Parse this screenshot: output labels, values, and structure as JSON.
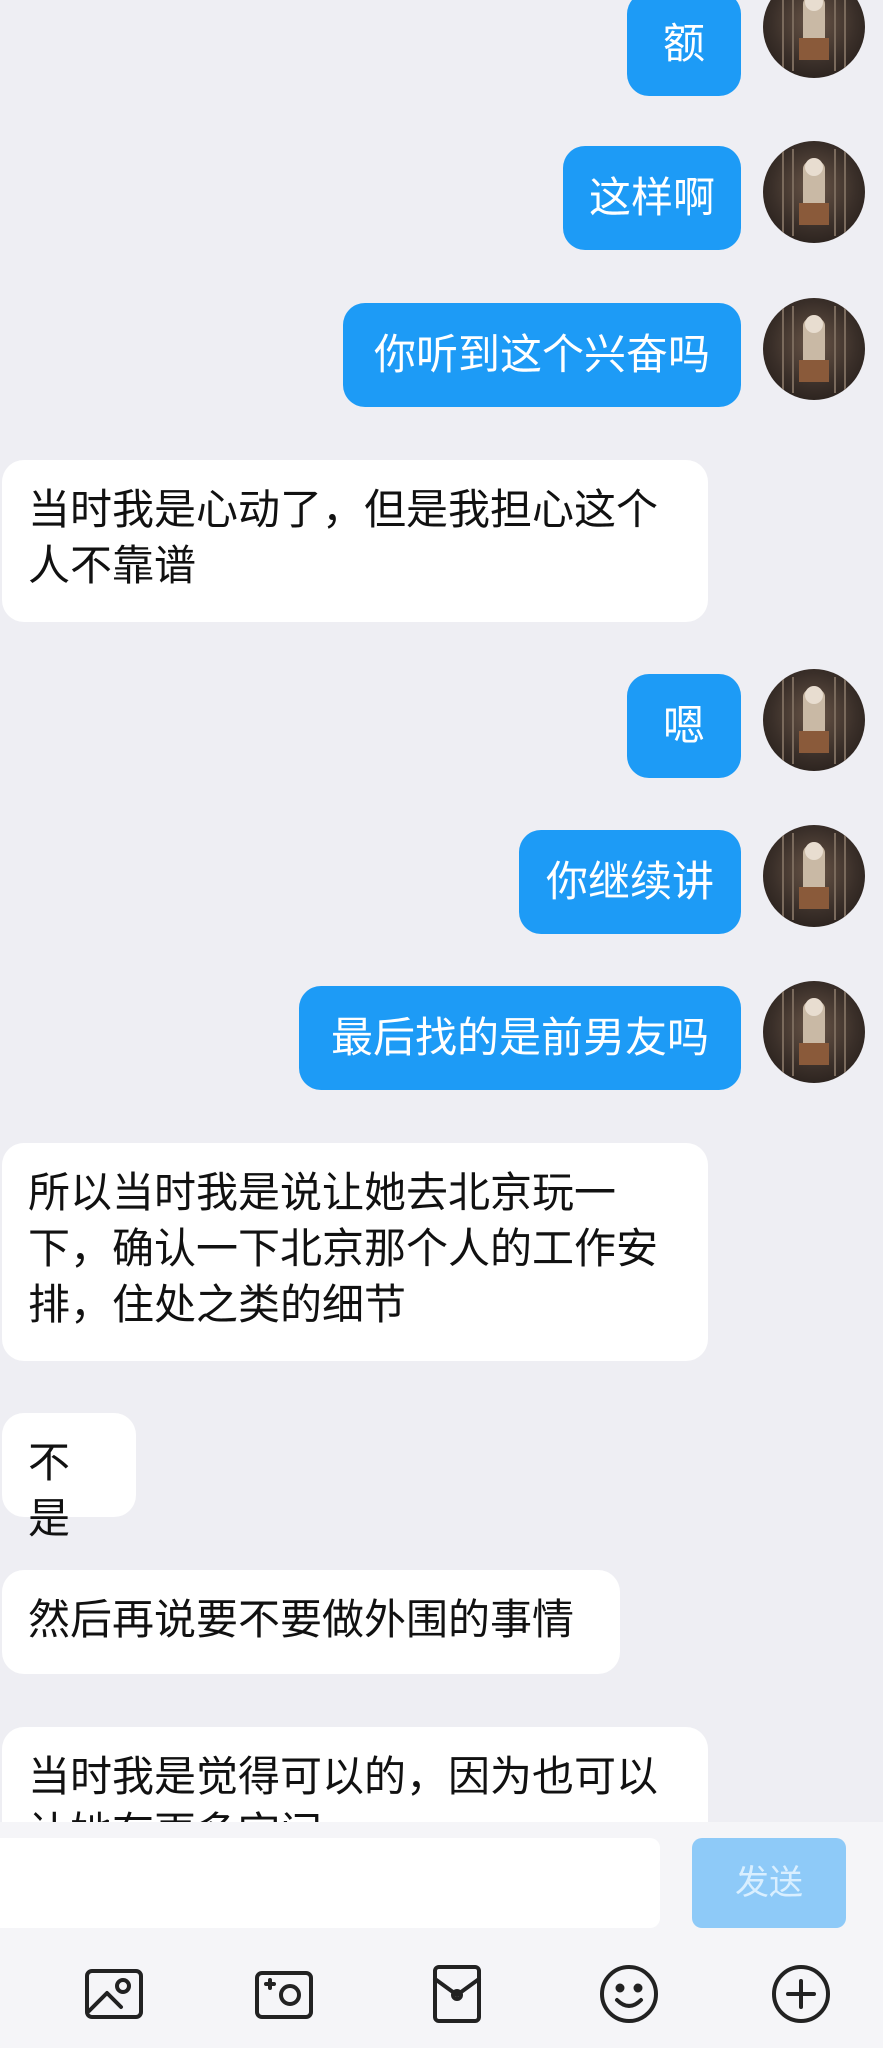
{
  "messages": [
    {
      "side": "sent",
      "text": "额"
    },
    {
      "side": "sent",
      "text": "这样啊"
    },
    {
      "side": "sent",
      "text": "你听到这个兴奋吗"
    },
    {
      "side": "recv",
      "text": "当时我是心动了，但是我担心这个\n人不靠谱"
    },
    {
      "side": "sent",
      "text": "嗯"
    },
    {
      "side": "sent",
      "text": "你继续讲"
    },
    {
      "side": "sent",
      "text": "最后找的是前男友吗"
    },
    {
      "side": "recv",
      "text": "所以当时我是说让她去北京玩一\n下，确认一下北京那个人的工作安\n排，住处之类的细节"
    },
    {
      "side": "recv",
      "text": "不是"
    },
    {
      "side": "recv",
      "text": "然后再说要不要做外围的事情"
    },
    {
      "side": "recv",
      "text": "当时我是觉得可以的，因为也可以\n让她有更多空间"
    }
  ],
  "composer": {
    "input_value": "",
    "send_label": "发送"
  },
  "toolbar": {
    "icons": [
      "image-icon",
      "camera-icon",
      "red-packet-icon",
      "emoji-icon",
      "plus-icon"
    ]
  },
  "colors": {
    "background": "#eeeef3",
    "sent_bubble": "#1d9bf6",
    "recv_bubble": "#ffffff",
    "send_button_disabled": "#8ecaf8"
  }
}
